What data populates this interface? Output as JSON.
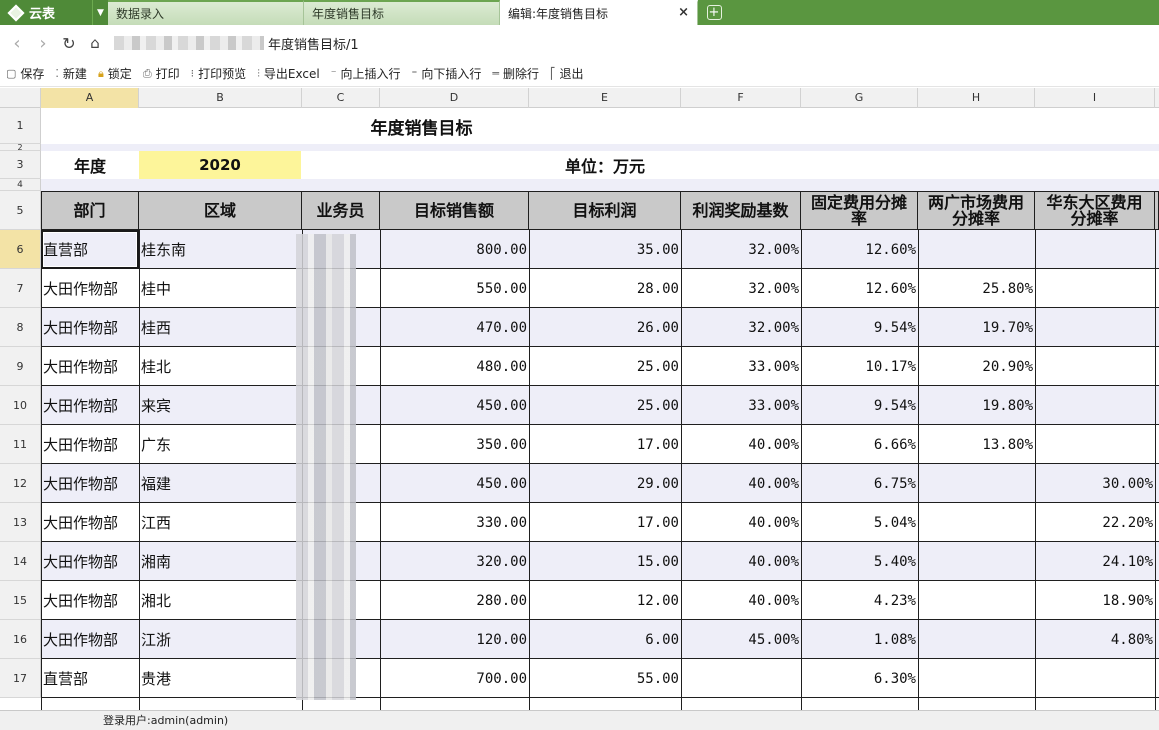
{
  "app": {
    "logo_label": "云表"
  },
  "tabs": [
    {
      "label": "数据录入",
      "active": false
    },
    {
      "label": "年度销售目标",
      "active": false
    },
    {
      "label": "编辑:年度销售目标",
      "active": true
    }
  ],
  "address": {
    "path": "年度销售目标/1"
  },
  "toolbar": [
    {
      "label": "保存",
      "icon": "save-icon"
    },
    {
      "label": "新建",
      "icon": "new-icon"
    },
    {
      "label": "锁定",
      "icon": "lock-icon"
    },
    {
      "label": "打印",
      "icon": "print-icon"
    },
    {
      "label": "打印预览",
      "icon": "print-preview-icon"
    },
    {
      "label": "导出Excel",
      "icon": "excel-icon"
    },
    {
      "label": "向上插入行",
      "icon": "insert-above-icon"
    },
    {
      "label": "向下插入行",
      "icon": "insert-below-icon"
    },
    {
      "label": "删除行",
      "icon": "delete-row-icon"
    },
    {
      "label": "退出",
      "icon": "exit-icon"
    }
  ],
  "columns": [
    "A",
    "B",
    "C",
    "D",
    "E",
    "F",
    "G",
    "H",
    "I"
  ],
  "sheet": {
    "title": "年度销售目标",
    "year_label": "年度",
    "year_value": "2020",
    "unit_label": "单位：万元",
    "headers": [
      "部门",
      "区域",
      "业务员",
      "目标销售额",
      "目标利润",
      "利润奖励基数",
      "固定费用分摊率",
      "两广市场费用分摊率",
      "华东大区费用分摊率"
    ],
    "rows": [
      {
        "row": "6",
        "dept": "直营部",
        "region": "桂东南",
        "sales": "800.00",
        "profit": "35.00",
        "base": "32.00%",
        "fixed": "12.60%",
        "gg": "",
        "hd": ""
      },
      {
        "row": "7",
        "dept": "大田作物部",
        "region": "桂中",
        "sales": "550.00",
        "profit": "28.00",
        "base": "32.00%",
        "fixed": "12.60%",
        "gg": "25.80%",
        "hd": ""
      },
      {
        "row": "8",
        "dept": "大田作物部",
        "region": "桂西",
        "sales": "470.00",
        "profit": "26.00",
        "base": "32.00%",
        "fixed": "9.54%",
        "gg": "19.70%",
        "hd": ""
      },
      {
        "row": "9",
        "dept": "大田作物部",
        "region": "桂北",
        "sales": "480.00",
        "profit": "25.00",
        "base": "33.00%",
        "fixed": "10.17%",
        "gg": "20.90%",
        "hd": ""
      },
      {
        "row": "10",
        "dept": "大田作物部",
        "region": "来宾",
        "sales": "450.00",
        "profit": "25.00",
        "base": "33.00%",
        "fixed": "9.54%",
        "gg": "19.80%",
        "hd": ""
      },
      {
        "row": "11",
        "dept": "大田作物部",
        "region": "广东",
        "sales": "350.00",
        "profit": "17.00",
        "base": "40.00%",
        "fixed": "6.66%",
        "gg": "13.80%",
        "hd": ""
      },
      {
        "row": "12",
        "dept": "大田作物部",
        "region": "福建",
        "sales": "450.00",
        "profit": "29.00",
        "base": "40.00%",
        "fixed": "6.75%",
        "gg": "",
        "hd": "30.00%"
      },
      {
        "row": "13",
        "dept": "大田作物部",
        "region": "江西",
        "sales": "330.00",
        "profit": "17.00",
        "base": "40.00%",
        "fixed": "5.04%",
        "gg": "",
        "hd": "22.20%"
      },
      {
        "row": "14",
        "dept": "大田作物部",
        "region": "湘南",
        "sales": "320.00",
        "profit": "15.00",
        "base": "40.00%",
        "fixed": "5.40%",
        "gg": "",
        "hd": "24.10%"
      },
      {
        "row": "15",
        "dept": "大田作物部",
        "region": "湘北",
        "sales": "280.00",
        "profit": "12.00",
        "base": "40.00%",
        "fixed": "4.23%",
        "gg": "",
        "hd": "18.90%"
      },
      {
        "row": "16",
        "dept": "大田作物部",
        "region": "江浙",
        "sales": "120.00",
        "profit": "6.00",
        "base": "45.00%",
        "fixed": "1.08%",
        "gg": "",
        "hd": "4.80%"
      },
      {
        "row": "17",
        "dept": "直营部",
        "region": "贵港",
        "sales": "700.00",
        "profit": "55.00",
        "base": "",
        "fixed": "6.30%",
        "gg": "",
        "hd": ""
      }
    ]
  },
  "status": {
    "user": "登录用户:admin(admin)"
  },
  "colors": {
    "header_fill": "#c9c9c9",
    "year_fill": "#fdf59a",
    "stripe": "#eeeef8",
    "selection": "#f3e3a6"
  }
}
